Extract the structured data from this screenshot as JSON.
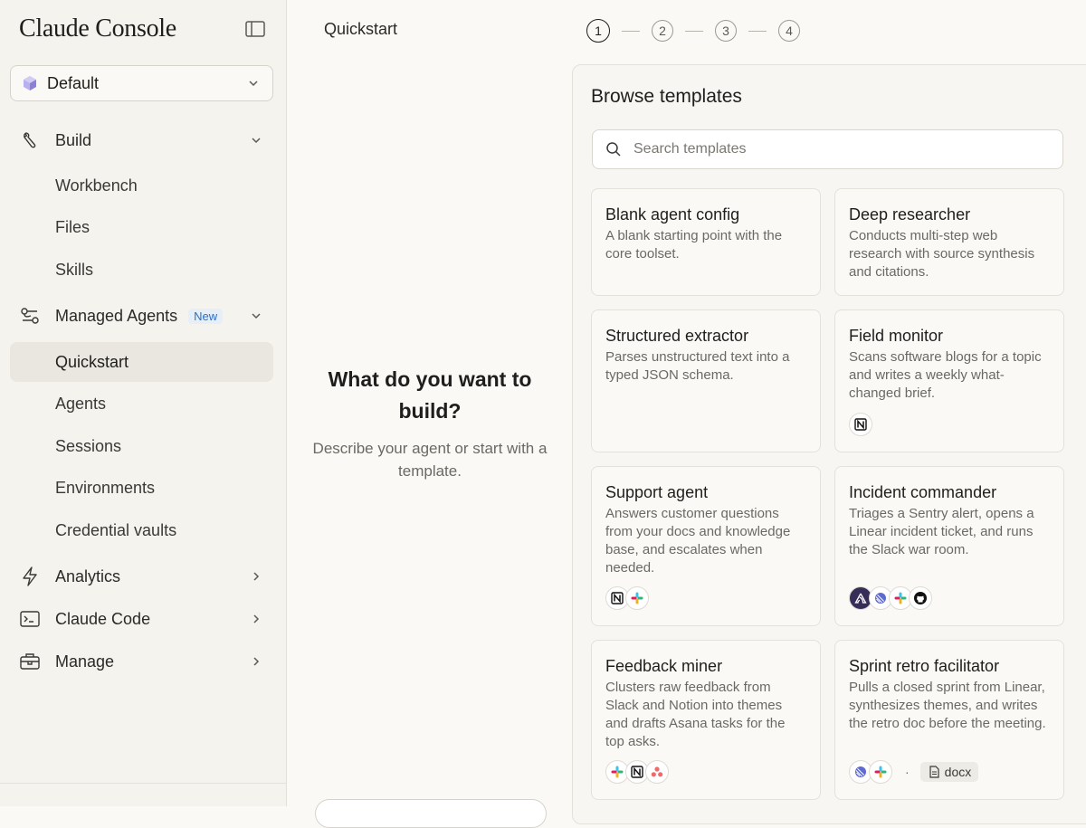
{
  "brand": "Claude Console",
  "workspace": {
    "label": "Default"
  },
  "sidebar": {
    "build": {
      "label": "Build",
      "items": [
        "Workbench",
        "Files",
        "Skills"
      ]
    },
    "managed_agents": {
      "label": "Managed Agents",
      "badge": "New",
      "items": [
        "Quickstart",
        "Agents",
        "Sessions",
        "Environments",
        "Credential vaults"
      ],
      "active": "Quickstart"
    },
    "analytics": {
      "label": "Analytics"
    },
    "claude_code": {
      "label": "Claude Code"
    },
    "manage": {
      "label": "Manage"
    }
  },
  "header": {
    "title": "Quickstart",
    "steps": [
      "1",
      "2",
      "3",
      "4"
    ],
    "current_step": "1"
  },
  "prompt": {
    "heading": "What do you want to build?",
    "subtext": "Describe your agent or start with a template."
  },
  "templates": {
    "title": "Browse templates",
    "search_placeholder": "Search templates",
    "cards": [
      {
        "title": "Blank agent config",
        "desc": "A blank starting point with the core toolset.",
        "icons": []
      },
      {
        "title": "Deep researcher",
        "desc": "Conducts multi-step web research with source synthesis and citations.",
        "icons": []
      },
      {
        "title": "Structured extractor",
        "desc": "Parses unstructured text into a typed JSON schema.",
        "icons": []
      },
      {
        "title": "Field monitor",
        "desc": "Scans software blogs for a topic and writes a weekly what-changed brief.",
        "icons": [
          "notion-icon"
        ]
      },
      {
        "title": "Support agent",
        "desc": "Answers customer questions from your docs and knowledge base, and escalates when needed.",
        "icons": [
          "notion-icon",
          "slack-icon"
        ]
      },
      {
        "title": "Incident commander",
        "desc": "Triages a Sentry alert, opens a Linear incident ticket, and runs the Slack war room.",
        "icons": [
          "sentry-icon",
          "linear-icon",
          "slack-icon",
          "github-icon"
        ]
      },
      {
        "title": "Feedback miner",
        "desc": "Clusters raw feedback from Slack and Notion into themes and drafts Asana tasks for the top asks.",
        "icons": [
          "slack-icon",
          "notion-icon",
          "asana-icon"
        ]
      },
      {
        "title": "Sprint retro facilitator",
        "desc": "Pulls a closed sprint from Linear, synthesizes themes, and writes the retro doc before the meeting.",
        "icons": [
          "linear-icon",
          "slack-icon"
        ],
        "separator": "·",
        "file_chip": "docx"
      }
    ]
  },
  "colors": {
    "accent_new_badge": "#2b6ec7",
    "active_nav_bg": "#e9e7e0",
    "workspace_cube": "#8b7fd8"
  }
}
